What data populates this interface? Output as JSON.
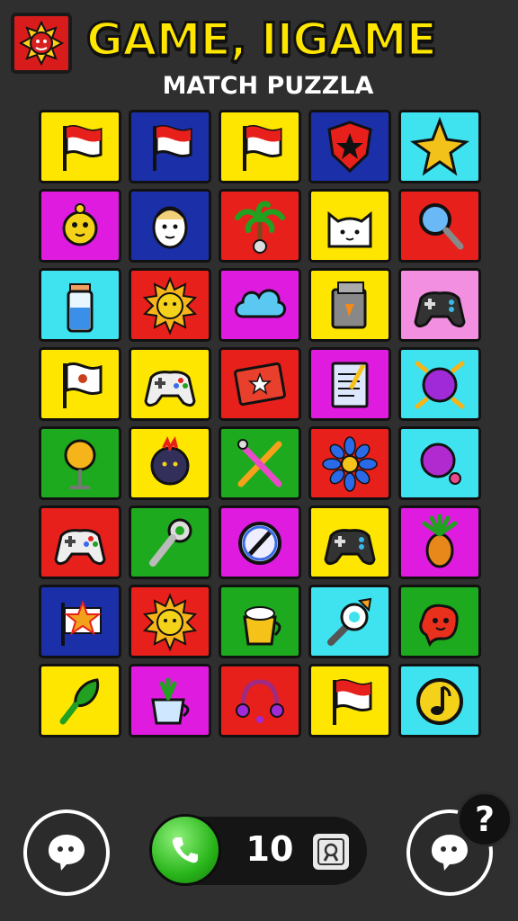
{
  "header": {
    "title": "GAME, IIGAME",
    "subtitle": "MATCH PUZZLA",
    "logo_icon": "red-face-logo-icon"
  },
  "board": {
    "rows": 8,
    "cols": 5,
    "tiles": [
      {
        "bg": "#ffe600",
        "icon": "red-flag"
      },
      {
        "bg": "#1b2fa8",
        "icon": "red-flag"
      },
      {
        "bg": "#ffe600",
        "icon": "red-flag"
      },
      {
        "bg": "#1b2fa8",
        "icon": "shield-star"
      },
      {
        "bg": "#3fe3f0",
        "icon": "gold-star"
      },
      {
        "bg": "#e01be0",
        "icon": "yellow-creature"
      },
      {
        "bg": "#1b2fa8",
        "icon": "face"
      },
      {
        "bg": "#e8201c",
        "icon": "palm-tree"
      },
      {
        "bg": "#ffe600",
        "icon": "cat"
      },
      {
        "bg": "#e8201c",
        "icon": "magnifier"
      },
      {
        "bg": "#3fe3f0",
        "icon": "bottle"
      },
      {
        "bg": "#e8201c",
        "icon": "sun"
      },
      {
        "bg": "#e01be0",
        "icon": "cloud"
      },
      {
        "bg": "#ffe600",
        "icon": "box"
      },
      {
        "bg": "#f28fe0",
        "icon": "gamepad"
      },
      {
        "bg": "#ffe600",
        "icon": "white-flag"
      },
      {
        "bg": "#ffe600",
        "icon": "gamepad-white"
      },
      {
        "bg": "#e8201c",
        "icon": "star-card"
      },
      {
        "bg": "#e01be0",
        "icon": "notepad"
      },
      {
        "bg": "#3fe3f0",
        "icon": "purple-ball"
      },
      {
        "bg": "#1eaa1e",
        "icon": "lollipop"
      },
      {
        "bg": "#ffe600",
        "icon": "berry"
      },
      {
        "bg": "#1eaa1e",
        "icon": "crossed-tools"
      },
      {
        "bg": "#e8201c",
        "icon": "flower"
      },
      {
        "bg": "#3fe3f0",
        "icon": "balloon"
      },
      {
        "bg": "#e8201c",
        "icon": "gamepad-white"
      },
      {
        "bg": "#1eaa1e",
        "icon": "key"
      },
      {
        "bg": "#e01be0",
        "icon": "compass"
      },
      {
        "bg": "#ffe600",
        "icon": "gamepad"
      },
      {
        "bg": "#e01be0",
        "icon": "pineapple"
      },
      {
        "bg": "#1b2fa8",
        "icon": "star-flag"
      },
      {
        "bg": "#e8201c",
        "icon": "sun"
      },
      {
        "bg": "#1eaa1e",
        "icon": "mug"
      },
      {
        "bg": "#3fe3f0",
        "icon": "tool"
      },
      {
        "bg": "#1eaa1e",
        "icon": "red-creature"
      },
      {
        "bg": "#ffe600",
        "icon": "green-leaf"
      },
      {
        "bg": "#e01be0",
        "icon": "plant-cup"
      },
      {
        "bg": "#e8201c",
        "icon": "headphones"
      },
      {
        "bg": "#ffe600",
        "icon": "red-flag"
      },
      {
        "bg": "#3fe3f0",
        "icon": "music-note"
      }
    ]
  },
  "footer": {
    "left_button_icon": "chat-bubble-icon",
    "right_button_icon": "chat-bubble-icon",
    "phone_icon": "phone-icon",
    "count": "10",
    "search_icon": "search-icon",
    "help_label": "?"
  }
}
